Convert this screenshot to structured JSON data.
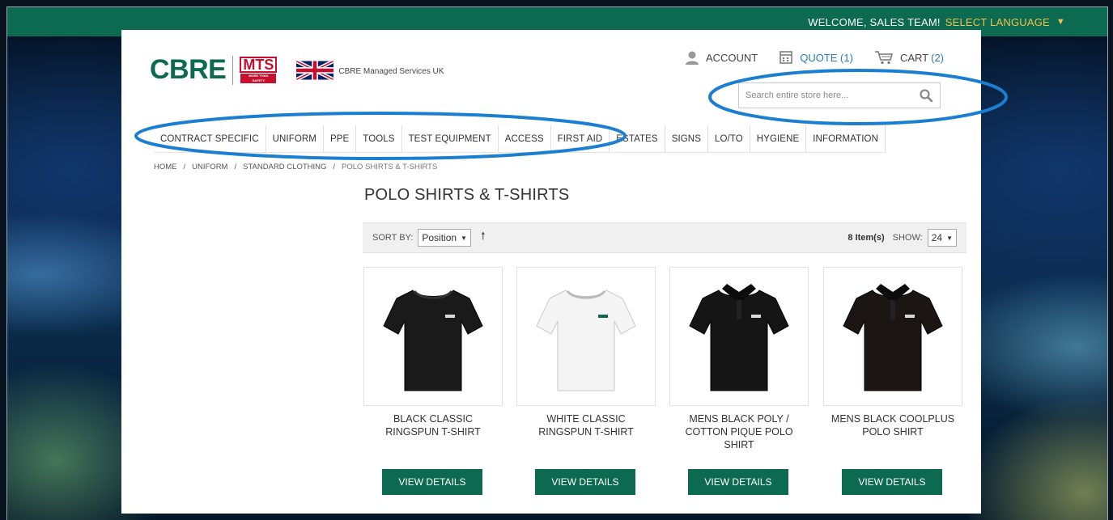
{
  "topbar": {
    "welcome": "WELCOME, SALES TEAM!",
    "select_language": "SELECT LANGUAGE",
    "caret_icon": "triangle-down-icon"
  },
  "header": {
    "logo_text": "CBRE",
    "mts_text": "MTS",
    "mts_tagline": "MORE THAN SAFETY",
    "company_name": "CBRE Managed Services UK",
    "account_label": "ACCOUNT",
    "quote_label": "QUOTE (1)",
    "cart_label": "CART",
    "cart_count": "(2)",
    "search_placeholder": "Search entire store here..."
  },
  "nav": {
    "items": [
      "CONTRACT SPECIFIC",
      "UNIFORM",
      "PPE",
      "TOOLS",
      "TEST EQUIPMENT",
      "ACCESS",
      "FIRST AID",
      "ESTATES",
      "SIGNS",
      "LO/TO",
      "HYGIENE",
      "INFORMATION"
    ]
  },
  "breadcrumb": [
    "HOME",
    "UNIFORM",
    "STANDARD CLOTHING",
    "POLO SHIRTS & T-SHIRTS"
  ],
  "breadcrumb_sep": "/",
  "page_title": "POLO SHIRTS & T-SHIRTS",
  "toolbar": {
    "sort_by_label": "SORT BY:",
    "sort_value": "Position",
    "item_count": "8 Item(s)",
    "show_label": "SHOW:",
    "show_value": "24"
  },
  "products": [
    {
      "name": "BLACK CLASSIC RINGSPUN T-SHIRT",
      "button": "VIEW DETAILS",
      "shirt_color": "#1a1a1a",
      "style": "tshirt"
    },
    {
      "name": "WHITE CLASSIC RINGSPUN T-SHIRT",
      "button": "VIEW DETAILS",
      "shirt_color": "#f4f4f4",
      "style": "tshirt"
    },
    {
      "name": "MENS BLACK POLY / COTTON PIQUE POLO SHIRT",
      "button": "VIEW DETAILS",
      "shirt_color": "#151515",
      "style": "polo"
    },
    {
      "name": "MENS BLACK COOLPLUS POLO SHIRT",
      "button": "VIEW DETAILS",
      "shirt_color": "#1b1613",
      "style": "polo"
    }
  ],
  "colors": {
    "brand_green": "#0b6a50",
    "accent_yellow": "#f2c14e",
    "link_blue": "#2a7ac5",
    "annotation_blue": "#1a7fd0"
  }
}
